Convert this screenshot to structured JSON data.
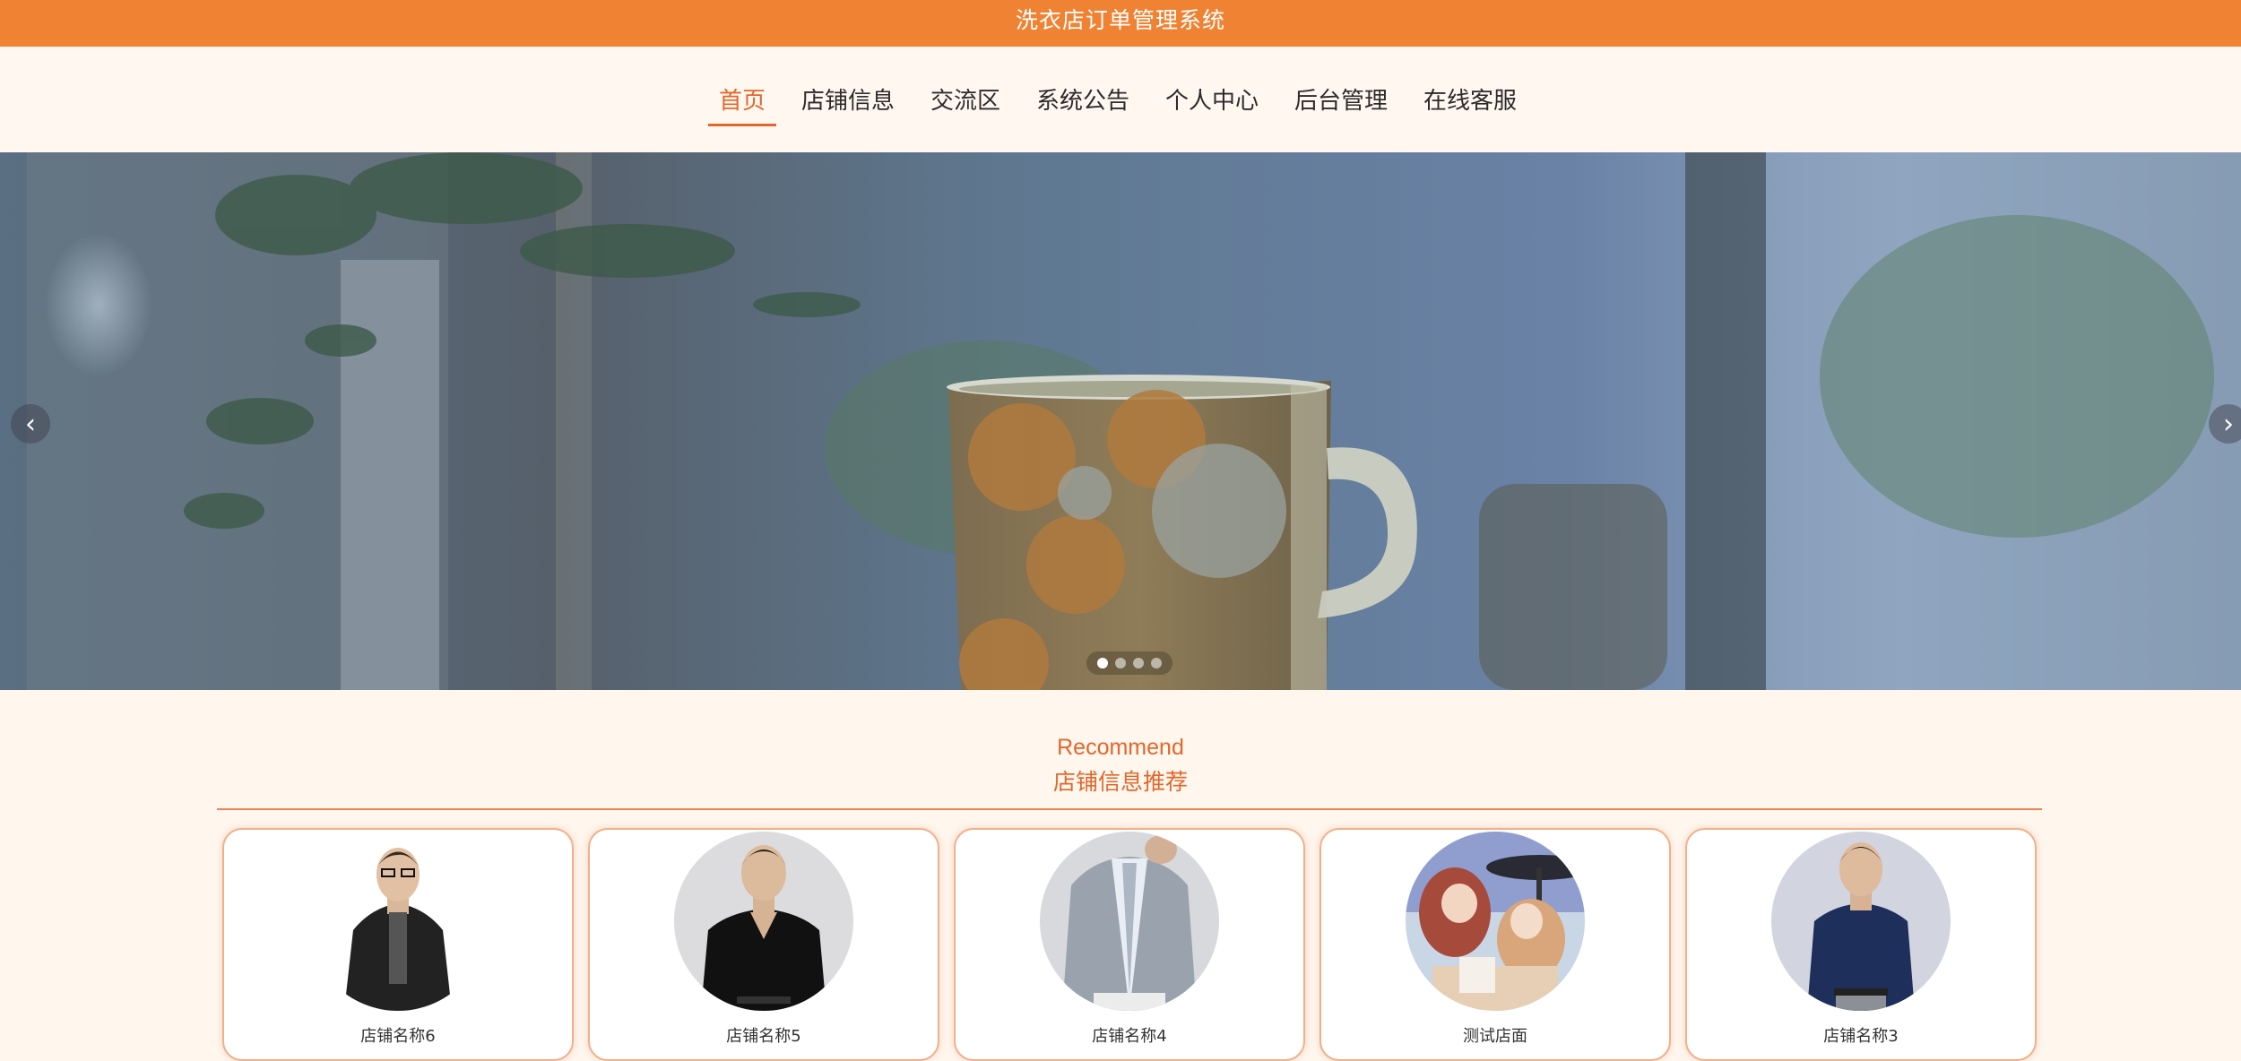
{
  "app": {
    "title": "洗衣店订单管理系统"
  },
  "nav": {
    "items": [
      {
        "label": "首页",
        "active": true
      },
      {
        "label": "店铺信息"
      },
      {
        "label": "交流区"
      },
      {
        "label": "系统公告"
      },
      {
        "label": "个人中心"
      },
      {
        "label": "后台管理"
      },
      {
        "label": "在线客服"
      }
    ]
  },
  "carousel": {
    "prev_icon": "chevron-left-icon",
    "next_icon": "chevron-right-icon",
    "slide_count": 4,
    "active_index": 0
  },
  "recommend": {
    "title_en": "Recommend",
    "title_cn": "店铺信息推荐",
    "shops": [
      {
        "name": "店铺名称6"
      },
      {
        "name": "店铺名称5"
      },
      {
        "name": "店铺名称4"
      },
      {
        "name": "测试店面"
      },
      {
        "name": "店铺名称3"
      }
    ]
  },
  "colors": {
    "header": "#ef8233",
    "accent": "#e2672a",
    "page_bg": "#fff6ee"
  }
}
